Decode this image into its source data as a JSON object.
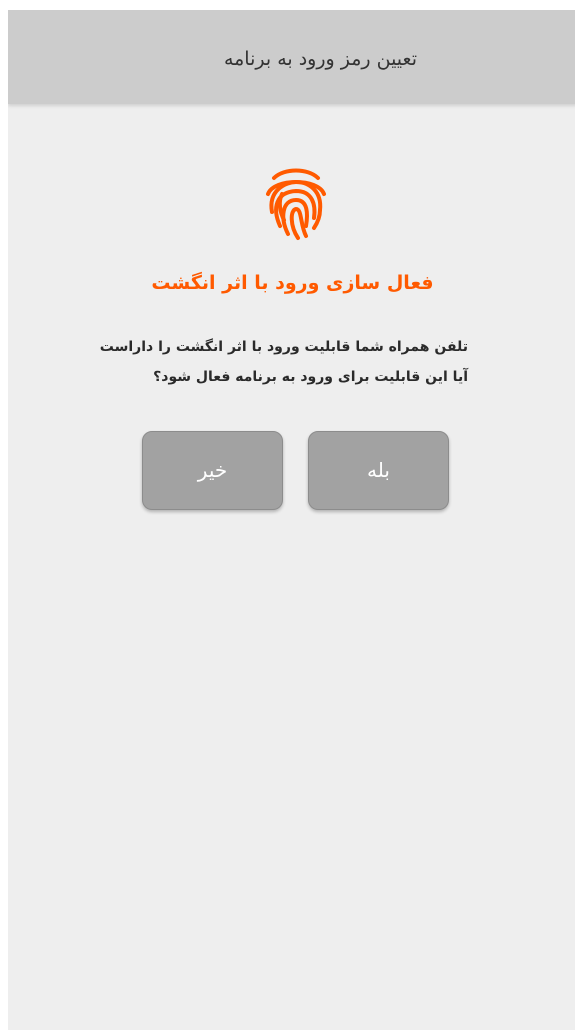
{
  "header": {
    "title": "تعیین رمز ورود به برنامه"
  },
  "fingerprint": {
    "icon": "fingerprint-icon",
    "color": "#ff5a00"
  },
  "main": {
    "headline": "فعال سازی ورود با اثر انگشت",
    "headline_color": "#ff5a00",
    "message_line1": "تلفن همراه شما قابلیت ورود با اثر انگشت را داراست",
    "message_line2": "آیا این قابلیت برای ورود به برنامه فعال شود؟"
  },
  "buttons": {
    "yes_label": "بله",
    "no_label": "خیر",
    "background": "#a2a2a2"
  }
}
